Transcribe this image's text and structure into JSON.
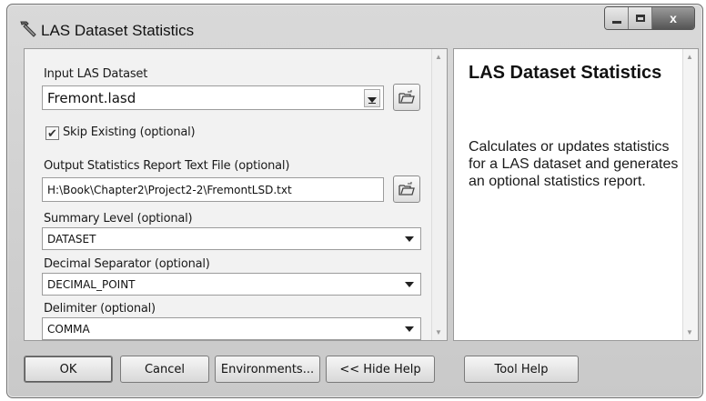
{
  "window": {
    "title": "LAS Dataset Statistics"
  },
  "params": {
    "input_dataset": {
      "label": "Input LAS Dataset",
      "value": "Fremont.lasd"
    },
    "skip_existing": {
      "label": "Skip Existing (optional)",
      "checked": true
    },
    "output_report": {
      "label": "Output Statistics Report Text File (optional)",
      "value": "H:\\Book\\Chapter2\\Project2-2\\FremontLSD.txt"
    },
    "summary_level": {
      "label": "Summary Level (optional)",
      "value": "DATASET"
    },
    "decimal_separator": {
      "label": "Decimal Separator (optional)",
      "value": "DECIMAL_POINT"
    },
    "delimiter": {
      "label": "Delimiter (optional)",
      "value": "COMMA"
    }
  },
  "help": {
    "title": "LAS Dataset Statistics",
    "description": "Calculates or updates statistics for a LAS dataset and generates an optional statistics report."
  },
  "buttons": {
    "ok": "OK",
    "cancel": "Cancel",
    "environments": "Environments...",
    "hide_help": "<< Hide Help",
    "tool_help": "Tool Help"
  },
  "icons": {
    "app": "hammer-icon",
    "browse": "folder-open-icon",
    "check": "✔",
    "close": "x"
  }
}
